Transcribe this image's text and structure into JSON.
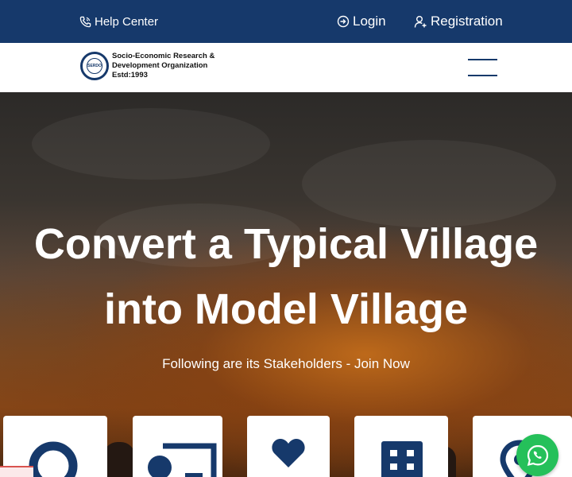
{
  "topbar": {
    "help_label": "Help Center",
    "login_label": "Login",
    "registration_label": "Registration"
  },
  "brand": {
    "logo_abbrev": "SERDO",
    "logo_ring_text": "INNOVATE",
    "name_line1": "Socio-Economic Research &",
    "name_line2": "Development Organization",
    "established": "Estd:1993"
  },
  "hero": {
    "title_line1": "Convert a Typical Village",
    "title_line2": "into Model Village",
    "subtitle": "Following are its Stakeholders - Join Now"
  },
  "stakeholder_cards": [
    {
      "icon": "user-icon"
    },
    {
      "icon": "id-card-icon"
    },
    {
      "icon": "heart-icon"
    },
    {
      "icon": "building-icon"
    },
    {
      "icon": "location-pin-icon"
    }
  ],
  "colors": {
    "brand_navy": "#16396b",
    "whatsapp_green": "#25c05a"
  }
}
